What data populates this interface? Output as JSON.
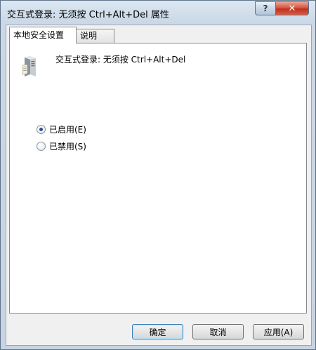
{
  "window": {
    "title": "交互式登录: 无须按 Ctrl+Alt+Del 属性"
  },
  "titlebar": {
    "help_label": "?",
    "close_label": "✕"
  },
  "tabs": [
    {
      "label": "本地安全设置"
    },
    {
      "label": "说明"
    }
  ],
  "policy": {
    "name": "交互式登录: 无须按 Ctrl+Alt+Del"
  },
  "options": [
    {
      "label": "已启用(E)",
      "selected": true
    },
    {
      "label": "已禁用(S)",
      "selected": false
    }
  ],
  "buttons": {
    "ok": "确定",
    "cancel": "取消",
    "apply": "应用(A)"
  }
}
